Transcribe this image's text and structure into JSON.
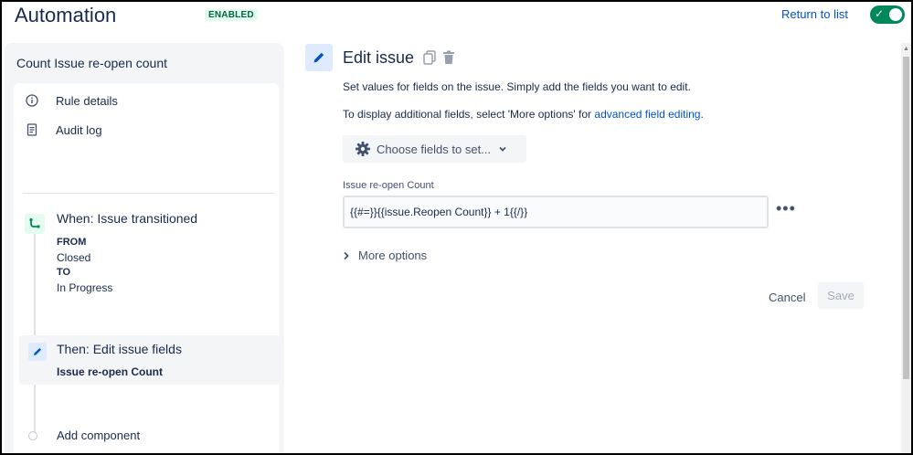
{
  "header": {
    "title": "Automation",
    "status_badge": "ENABLED",
    "return_link": "Return to list",
    "toggle_state": "on"
  },
  "sidebar": {
    "rule_name": "Count Issue re-open count",
    "links": [
      {
        "label": "Rule details",
        "icon": "info-icon"
      },
      {
        "label": "Audit log",
        "icon": "document-icon"
      }
    ],
    "trigger": {
      "title": "When: Issue transitioned",
      "from_label": "FROM",
      "from_value": "Closed",
      "to_label": "TO",
      "to_value": "In Progress"
    },
    "action": {
      "title": "Then: Edit issue fields",
      "subtitle": "Issue re-open Count"
    },
    "add_component": "Add component"
  },
  "main": {
    "title": "Edit issue",
    "description": "Set values for fields on the issue. Simply add the fields you want to edit.",
    "more_text": "To display additional fields, select 'More options' for ",
    "more_link": "advanced field editing",
    "more_suffix": ".",
    "choose_fields": "Choose fields to set...",
    "field_label": "Issue re-open Count",
    "field_value": "{{#=}}{{issue.Reopen Count}} + 1{{/}}",
    "more_options": "More options",
    "cancel": "Cancel",
    "save": "Save"
  },
  "colors": {
    "accent": "#0052cc",
    "enabled_bg": "#e3fcef",
    "enabled_text": "#006644",
    "toggle_on": "#00875a",
    "sidebar_bg": "#f4f5f7"
  }
}
